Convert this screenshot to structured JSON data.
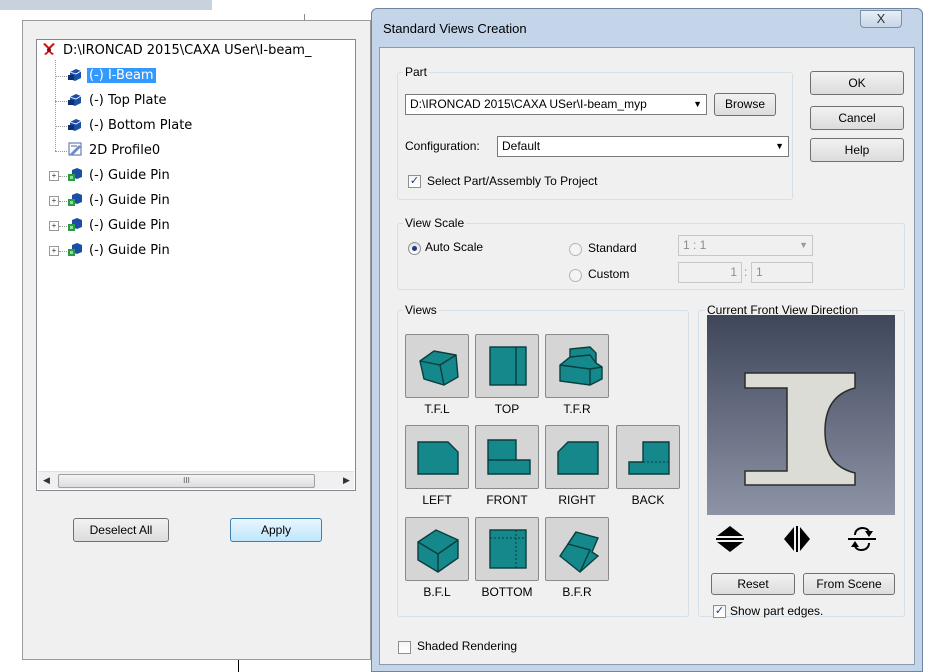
{
  "tree": {
    "root_label": "D:\\IRONCAD 2015\\CAXA USer\\I-beam_",
    "items": [
      {
        "label": "(-) I-Beam",
        "icon": "part-icon",
        "selected": true,
        "expandable": false
      },
      {
        "label": "(-) Top Plate",
        "icon": "part-icon",
        "selected": false,
        "expandable": false
      },
      {
        "label": "(-) Bottom Plate",
        "icon": "part-icon",
        "selected": false,
        "expandable": false
      },
      {
        "label": "2D Profile0",
        "icon": "profile-icon",
        "selected": false,
        "expandable": false
      },
      {
        "label": "(-) Guide Pin",
        "icon": "assembly-icon",
        "selected": false,
        "expandable": true
      },
      {
        "label": "(-) Guide Pin",
        "icon": "assembly-icon",
        "selected": false,
        "expandable": true
      },
      {
        "label": "(-) Guide Pin",
        "icon": "assembly-icon",
        "selected": false,
        "expandable": true
      },
      {
        "label": "(-) Guide Pin",
        "icon": "assembly-icon",
        "selected": false,
        "expandable": true
      }
    ],
    "scroll_grip": "III"
  },
  "left_buttons": {
    "deselect_all": "Deselect All",
    "apply": "Apply"
  },
  "dialog": {
    "title": "Standard Views Creation",
    "close_glyph": "X",
    "part_group": "Part",
    "part_path": "D:\\IRONCAD 2015\\CAXA USer\\I-beam_myp",
    "browse": "Browse",
    "configuration_label": "Configuration:",
    "configuration_value": "Default",
    "select_part_label": "Select Part/Assembly To Project",
    "select_part_checked": true,
    "ok": "OK",
    "cancel": "Cancel",
    "help": "Help",
    "view_scale_group": "View Scale",
    "auto_scale": "Auto Scale",
    "standard": "Standard",
    "custom": "Custom",
    "standard_scale_value": "1 : 1",
    "custom_scale_a": "1",
    "custom_scale_sep": ":",
    "custom_scale_b": "1",
    "scale_mode": "auto",
    "views_group": "Views",
    "views": [
      {
        "label": "T.F.L",
        "icon": "top-front-left-view-icon"
      },
      {
        "label": "TOP",
        "icon": "top-view-icon"
      },
      {
        "label": "T.F.R",
        "icon": "top-front-right-view-icon"
      },
      {
        "label": "LEFT",
        "icon": "left-view-icon"
      },
      {
        "label": "FRONT",
        "icon": "front-view-icon"
      },
      {
        "label": "RIGHT",
        "icon": "right-view-icon"
      },
      {
        "label": "BACK",
        "icon": "back-view-icon"
      },
      {
        "label": "B.F.L",
        "icon": "bottom-front-left-view-icon"
      },
      {
        "label": "BOTTOM",
        "icon": "bottom-view-icon"
      },
      {
        "label": "B.F.R",
        "icon": "bottom-front-right-view-icon"
      }
    ],
    "front_view_group": "Current Front View Direction",
    "reset": "Reset",
    "from_scene": "From Scene",
    "show_part_edges": "Show part edges.",
    "show_part_edges_checked": true,
    "shaded_rendering": "Shaded Rendering",
    "shaded_rendering_checked": false
  },
  "colors": {
    "view_teal": "#14888a",
    "selection": "#3399ff",
    "dialog_frame": "#c4d5ea"
  }
}
